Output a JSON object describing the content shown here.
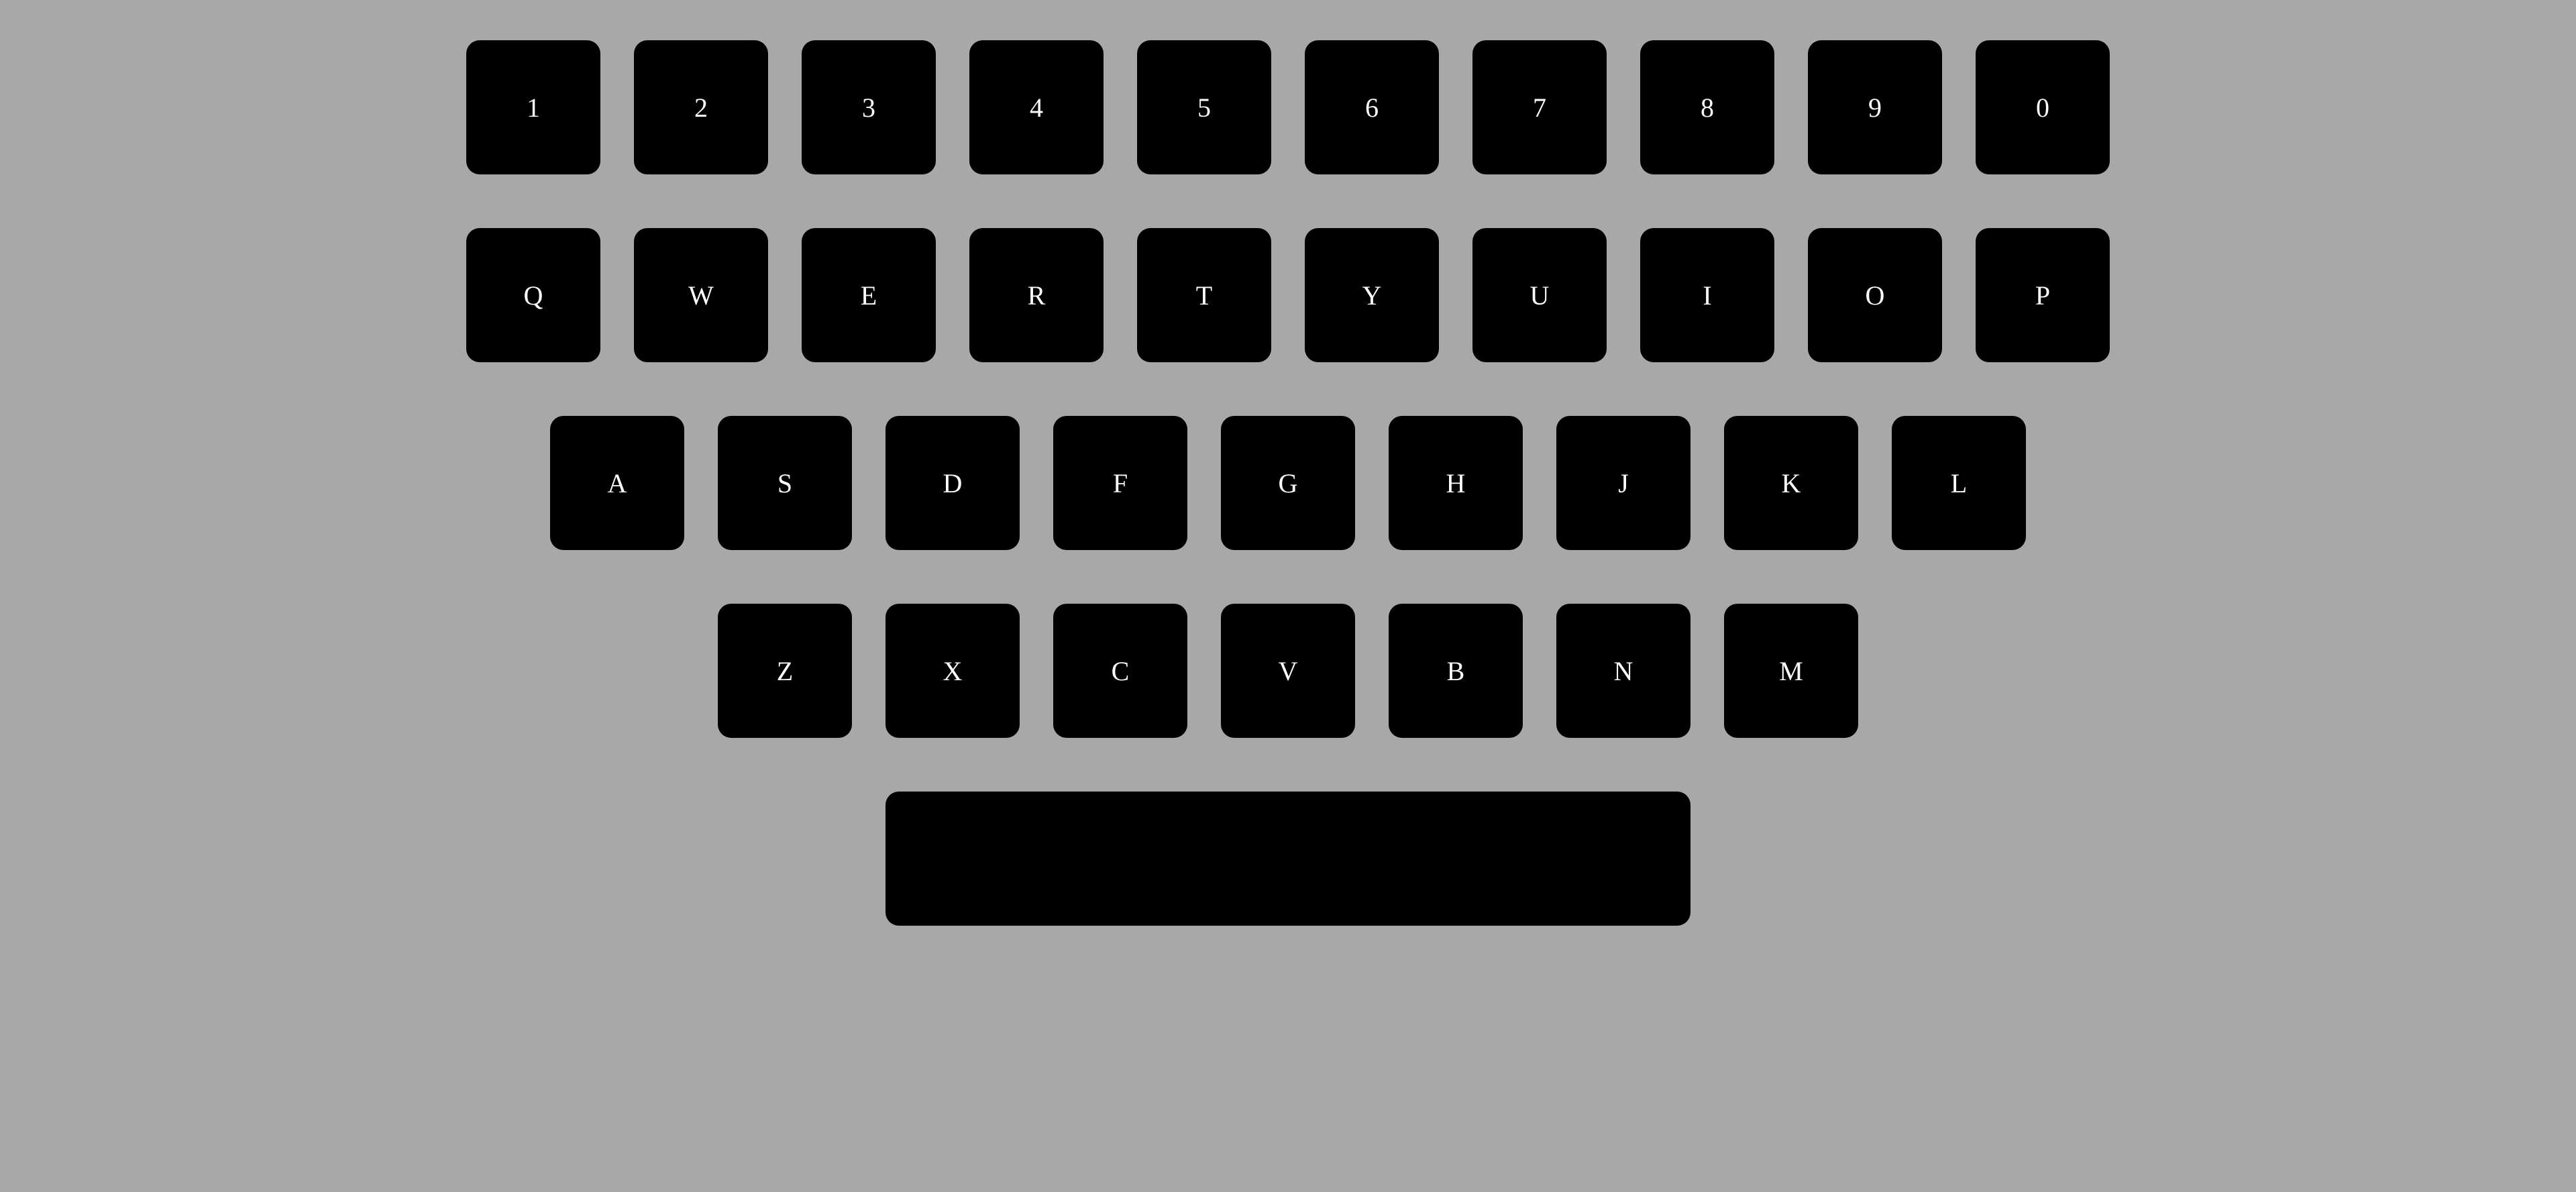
{
  "keyboard": {
    "rows": [
      [
        "1",
        "2",
        "3",
        "4",
        "5",
        "6",
        "7",
        "8",
        "9",
        "0"
      ],
      [
        "Q",
        "W",
        "E",
        "R",
        "T",
        "Y",
        "U",
        "I",
        "O",
        "P"
      ],
      [
        "A",
        "S",
        "D",
        "F",
        "G",
        "H",
        "J",
        "K",
        "L"
      ],
      [
        "Z",
        "X",
        "C",
        "V",
        "B",
        "N",
        "M"
      ]
    ],
    "space_label": ""
  },
  "colors": {
    "background": "#a8a8a8",
    "key": "#000000",
    "key_text": "#ffffff"
  }
}
